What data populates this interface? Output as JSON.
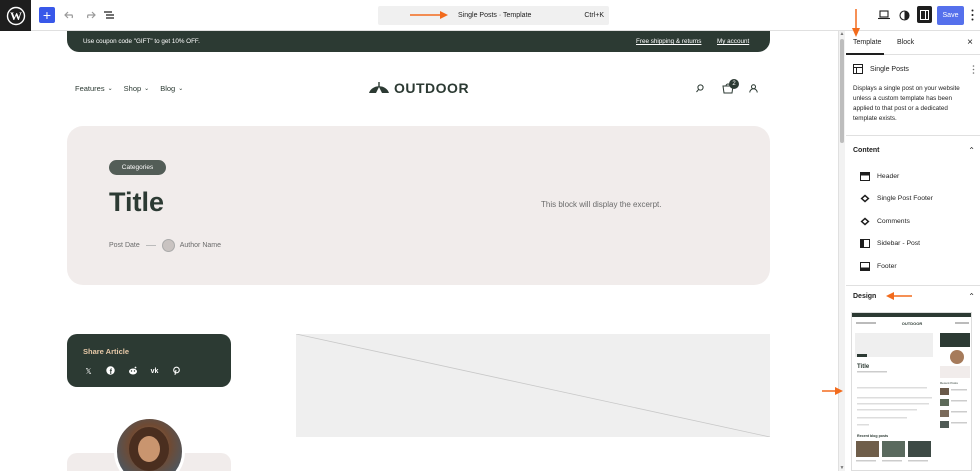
{
  "toolbar": {
    "add_label": "+",
    "command_title": "Single Posts · Template",
    "command_shortcut": "Ctrl+K",
    "save_label": "Save"
  },
  "promo": {
    "text": "Use coupon code \"GIFT\" to get 10% OFF.",
    "link1": "Free shipping & returns",
    "link2": "My account"
  },
  "nav": {
    "items": [
      "Features",
      "Shop",
      "Blog"
    ],
    "logo": "OUTDOOR",
    "cart_count": "2"
  },
  "hero": {
    "category": "Categories",
    "title": "Title",
    "post_date": "Post Date",
    "author": "Author Name",
    "excerpt": "This block will display the excerpt."
  },
  "share": {
    "title": "Share Article"
  },
  "sidebar": {
    "tab_template": "Template",
    "tab_block": "Block",
    "template_name": "Single Posts",
    "template_desc": "Displays a single post on your website unless a custom template has been applied to that post or a dedicated template exists.",
    "content_heading": "Content",
    "content_items": [
      "Header",
      "Single Post Footer",
      "Comments",
      "Sidebar - Post",
      "Footer"
    ],
    "design_heading": "Design"
  },
  "preview": {
    "logo": "OUTDOOR",
    "title": "Title",
    "recent_posts": "Recent Posts",
    "recent_heading": "Recent blog posts"
  },
  "colors": {
    "accent": "#3858e9",
    "dark_green": "#2c3a33",
    "hero_bg": "#f1eceb",
    "annotation": "#f26b1d"
  }
}
